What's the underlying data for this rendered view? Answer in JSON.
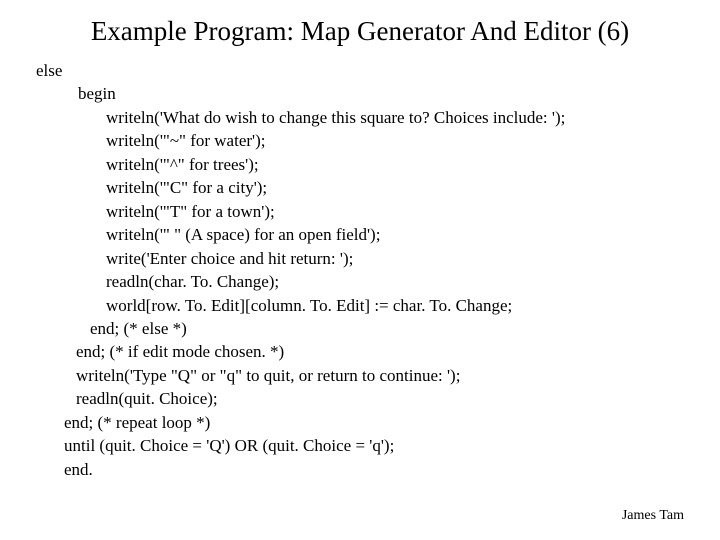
{
  "title": "Example Program: Map Generator And Editor (6)",
  "code": {
    "l01": "else",
    "l02": "begin",
    "l03": "writeln('What do wish to change this square to? Choices include: ');",
    "l04": "writeln('\"~\" for water');",
    "l05": "writeln('\"^\" for trees');",
    "l06": "writeln('\"C\" for a city');",
    "l07": "writeln('\"T\" for a town');",
    "l08": "writeln('\" \" (A space) for an open field');",
    "l09": "write('Enter choice and hit return: ');",
    "l10": "readln(char. To. Change);",
    "l11": "world[row. To. Edit][column. To. Edit] := char. To. Change;",
    "l12": "end; (* else *)",
    "l13": "end; (* if edit mode chosen. *)",
    "l14": "writeln('Type \"Q\" or \"q\" to quit, or return to continue: ');",
    "l15": "readln(quit. Choice);",
    "l16": "end; (* repeat loop *)",
    "l17": "until (quit. Choice = 'Q') OR (quit. Choice = 'q');",
    "l18": "end."
  },
  "footer": "James Tam"
}
